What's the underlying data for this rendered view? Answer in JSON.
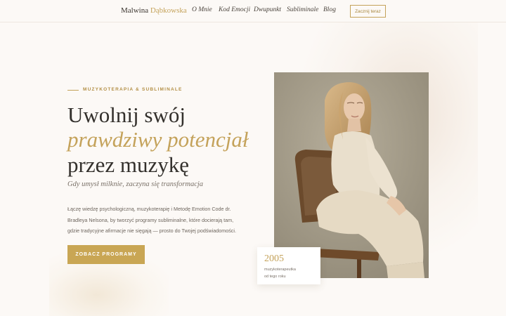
{
  "header": {
    "logo_first": "Malwina",
    "logo_last": "Dąbkowska",
    "nav": [
      "O Mnie",
      "Kod Emocji",
      "Dwupunkt",
      "Subliminale",
      "Blog"
    ],
    "cta": "Zacznij teraz"
  },
  "hero": {
    "eyebrow": "MUZYKOTERAPIA & SUBLIMINALE",
    "heading_line1": "Uwolnij swój",
    "heading_line2": "prawdziwy potencjał",
    "heading_line3": "przez muzykę",
    "tagline": "Gdy umysł milknie, zaczyna się transformacja",
    "body_line1": "Łączę wiedzę psychologiczną, muzykoterapię i Metodę Emotion Code dr.",
    "body_line2": "Bradleya Nelsona, by tworzyć programy subliminalne, które docierają tam,",
    "body_line3": "gdzie tradycyjne afirmacje nie sięgają — prosto do Twojej podświadomości.",
    "button": "ZOBACZ PROGRAMY"
  },
  "stat": {
    "year": "2005",
    "label_line1": "muzykoterapeutka",
    "label_line2": "od tego roku"
  },
  "colors": {
    "accent": "#c4a25a",
    "background": "#fcf9f6",
    "text": "#33302c"
  }
}
